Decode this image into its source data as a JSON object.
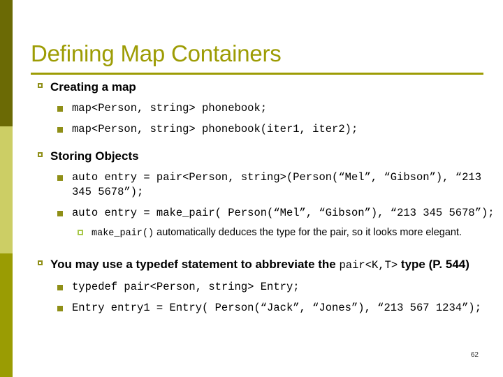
{
  "slide": {
    "title": "Defining Map Containers",
    "page_number": "62",
    "accent_color": "#9d9c04",
    "bullet_l1_color": "#8f8f17",
    "bullet_l2_color": "#8f8f17",
    "bullet_l3_color": "#a8c84a",
    "stripe_colors": {
      "top": "#6b6a05",
      "middle": "#ccce65",
      "bottom": "#9a9c03"
    }
  },
  "sections": [
    {
      "heading": "Creating a map",
      "items": [
        {
          "text": "map<Person, string> phonebook;"
        },
        {
          "text": "map<Person, string> phonebook(iter1, iter2);"
        }
      ]
    },
    {
      "heading": "Storing Objects",
      "items": [
        {
          "text": "auto entry = pair<Person, string>(Person(“Mel”, “Gibson”), “213 345 5678”);"
        },
        {
          "text": "auto entry = make_pair( Person(“Mel”, “Gibson”), “213 345 5678”);",
          "subitems": [
            {
              "code": "make_pair()",
              "text": " automatically deduces the type for the pair, so it looks more elegant."
            }
          ]
        }
      ]
    },
    {
      "heading_part1": "You may use a typedef statement to abbreviate the ",
      "heading_code": "pair<K,T>",
      "heading_part2": " type (P. 544)",
      "items": [
        {
          "text": "typedef pair<Person, string> Entry;"
        },
        {
          "text": "Entry entry1 = Entry( Person(“Jack”, “Jones”), “213 567 1234”);"
        }
      ]
    }
  ]
}
